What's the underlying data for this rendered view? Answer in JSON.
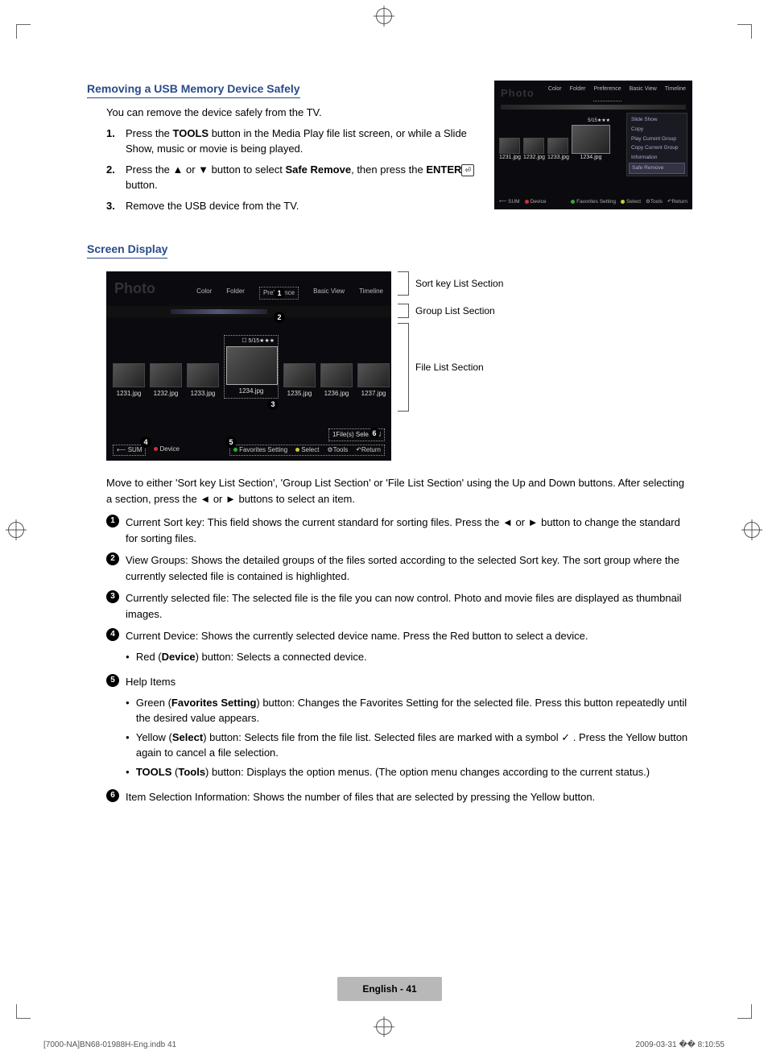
{
  "section1": {
    "heading": "Removing a USB Memory Device Safely",
    "intro": "You can remove the device safely from the TV.",
    "steps": [
      {
        "num": "1.",
        "pre": "Press the ",
        "b1": "TOOLS",
        "post": " button in the Media Play file list screen, or while a Slide Show, music or movie is being played."
      },
      {
        "num": "2.",
        "pre": "Press the ▲ or ▼ button to select ",
        "b1": "Safe Remove",
        "mid": ", then press the ",
        "b2": "ENTER",
        "post": " button."
      },
      {
        "num": "3.",
        "pre": "Remove the USB device from the TV."
      }
    ]
  },
  "tv_small": {
    "photo": "Photo",
    "tabs": [
      "Color",
      "Folder",
      "Preference",
      "Basic View",
      "Timeline"
    ],
    "count": "5/15★★★",
    "thumbs": [
      "1231.jpg",
      "1232.jpg",
      "1233.jpg"
    ],
    "big": "1234.jpg",
    "menu": [
      "Slide Show",
      "Copy",
      "Play Current Group",
      "Copy Current Group",
      "Information",
      "Safe Remove"
    ],
    "footer_l": [
      "SUM",
      "Device"
    ],
    "footer_r": [
      "Favorites Setting",
      "Select",
      "Tools",
      "Return"
    ]
  },
  "section2": {
    "heading": "Screen Display",
    "labels": [
      "Sort key List Section",
      "Group List Section",
      "File List Section"
    ]
  },
  "tv_big": {
    "photo": "Photo",
    "tabs": [
      "Color",
      "Folder",
      "Preference",
      "Basic View",
      "Timeline"
    ],
    "count": "5/15★★★",
    "thumbs": [
      "1231.jpg",
      "1232.jpg",
      "1233.jpg",
      "1234.jpg",
      "1235.jpg",
      "1236.jpg",
      "1237.jpg"
    ],
    "selinfo": "1File(s) Selected",
    "bot_l": [
      "SUM",
      "Device"
    ],
    "bot_r": [
      "Favorites Setting",
      "Select",
      "Tools",
      "Return"
    ]
  },
  "explain": {
    "para": "Move to either 'Sort key List Section', 'Group List Section' or 'File List Section' using the Up and Down buttons. After selecting a section, press the ◄ or ► buttons to select an item.",
    "items": [
      {
        "n": "1",
        "text": "Current Sort key: This field shows the current standard for sorting files. Press the ◄ or ► button to change the standard for sorting files."
      },
      {
        "n": "2",
        "text": "View Groups: Shows the detailed groups of the files sorted according to the selected Sort key. The sort group where the currently selected file is contained is highlighted."
      },
      {
        "n": "3",
        "text": "Currently selected file: The selected file is the file you can now control. Photo and movie files are displayed as thumbnail images."
      },
      {
        "n": "4",
        "text": "Current Device: Shows the currently selected device name. Press the Red button to select a device.",
        "subs": [
          {
            "pre": "Red (",
            "b": "Device",
            "post": ") button: Selects a connected device."
          }
        ]
      },
      {
        "n": "5",
        "text": "Help Items",
        "subs": [
          {
            "pre": "Green (",
            "b": "Favorites Setting",
            "post": ") button: Changes the Favorites Setting for the selected file. Press this button repeatedly until the desired value appears."
          },
          {
            "pre": "Yellow (",
            "b": "Select",
            "post": ") button: Selects file from the file list. Selected files are marked with a symbol ✓ . Press the Yellow button again to cancel a file selection."
          },
          {
            "preB": "TOOLS",
            "pre2": " (",
            "b": "Tools",
            "post": ") button: Displays the option menus. (The option menu changes according to the current status.)"
          }
        ]
      },
      {
        "n": "6",
        "text": "Item Selection Information: Shows the number of files that are selected by pressing the Yellow button."
      }
    ]
  },
  "footer": {
    "page": "English - 41",
    "left": "[7000-NA]BN68-01988H-Eng.indb   41",
    "right": "2009-03-31   �� 8:10:55"
  }
}
